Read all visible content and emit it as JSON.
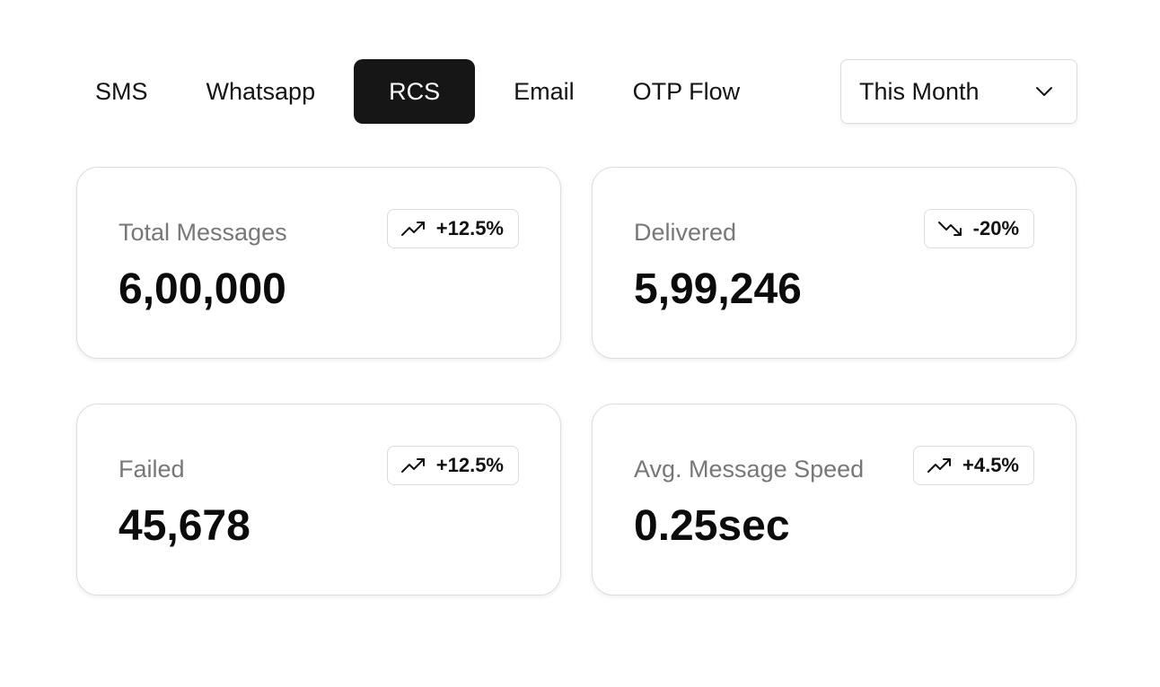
{
  "tabs": [
    {
      "label": "SMS",
      "active": false
    },
    {
      "label": "Whatsapp",
      "active": false
    },
    {
      "label": "RCS",
      "active": true
    },
    {
      "label": "Email",
      "active": false
    },
    {
      "label": "OTP Flow",
      "active": false
    }
  ],
  "period_select": {
    "value": "This Month",
    "icon": "chevron-down-icon"
  },
  "cards": [
    {
      "label": "Total Messages",
      "value": "6,00,000",
      "change": "+12.5%",
      "trend": "up",
      "icon": "trending-up-icon"
    },
    {
      "label": "Delivered",
      "value": "5,99,246",
      "change": "-20%",
      "trend": "down",
      "icon": "trending-down-icon"
    },
    {
      "label": "Failed",
      "value": "45,678",
      "change": "+12.5%",
      "trend": "up",
      "icon": "trending-up-icon"
    },
    {
      "label": "Avg. Message Speed",
      "value": "0.25sec",
      "change": "+4.5%",
      "trend": "up",
      "icon": "trending-up-icon"
    }
  ],
  "colors": {
    "active_tab_bg": "#161616",
    "active_tab_text": "#ffffff",
    "label_text": "#777777",
    "value_text": "#0b0b0b",
    "border": "#dddddd"
  }
}
